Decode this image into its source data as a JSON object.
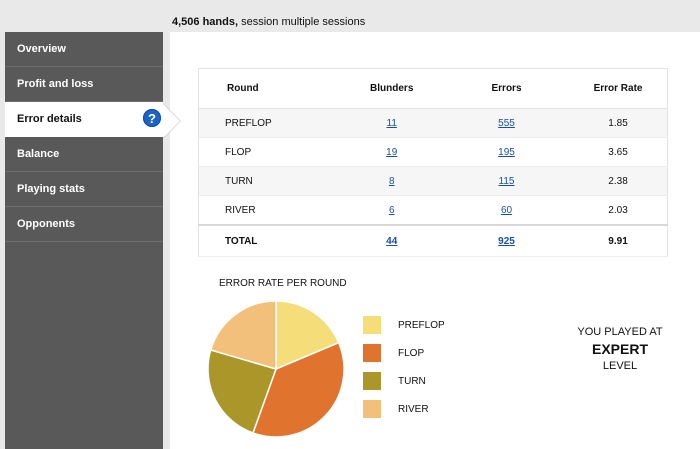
{
  "header": {
    "hands": "4,506 hands,",
    "session": " session multiple sessions"
  },
  "sidebar": {
    "items": [
      {
        "label": "Overview"
      },
      {
        "label": "Profit and loss"
      },
      {
        "label": "Error details"
      },
      {
        "label": "Balance"
      },
      {
        "label": "Playing stats"
      },
      {
        "label": "Opponents"
      }
    ],
    "help_glyph": "?"
  },
  "table": {
    "headers": [
      "Round",
      "Blunders",
      "Errors",
      "Error Rate"
    ],
    "rows": [
      {
        "round": "PREFLOP",
        "blunders": "11",
        "errors": "555",
        "rate": "1.85"
      },
      {
        "round": "FLOP",
        "blunders": "19",
        "errors": "195",
        "rate": "3.65"
      },
      {
        "round": "TURN",
        "blunders": "8",
        "errors": "115",
        "rate": "2.38"
      },
      {
        "round": "RIVER",
        "blunders": "6",
        "errors": "60",
        "rate": "2.03"
      }
    ],
    "total": {
      "round": "TOTAL",
      "blunders": "44",
      "errors": "925",
      "rate": "9.91"
    }
  },
  "chart_data": {
    "type": "pie",
    "title": "ERROR RATE PER ROUND",
    "categories": [
      "PREFLOP",
      "FLOP",
      "TURN",
      "RIVER"
    ],
    "values": [
      1.85,
      3.65,
      2.38,
      2.03
    ],
    "colors": [
      "#f5dd7a",
      "#e0732d",
      "#ab962a",
      "#f2c07a"
    ],
    "legend_position": "right"
  },
  "verdict": {
    "line1": "YOU PLAYED AT",
    "level": "EXPERT",
    "line3": "LEVEL"
  }
}
